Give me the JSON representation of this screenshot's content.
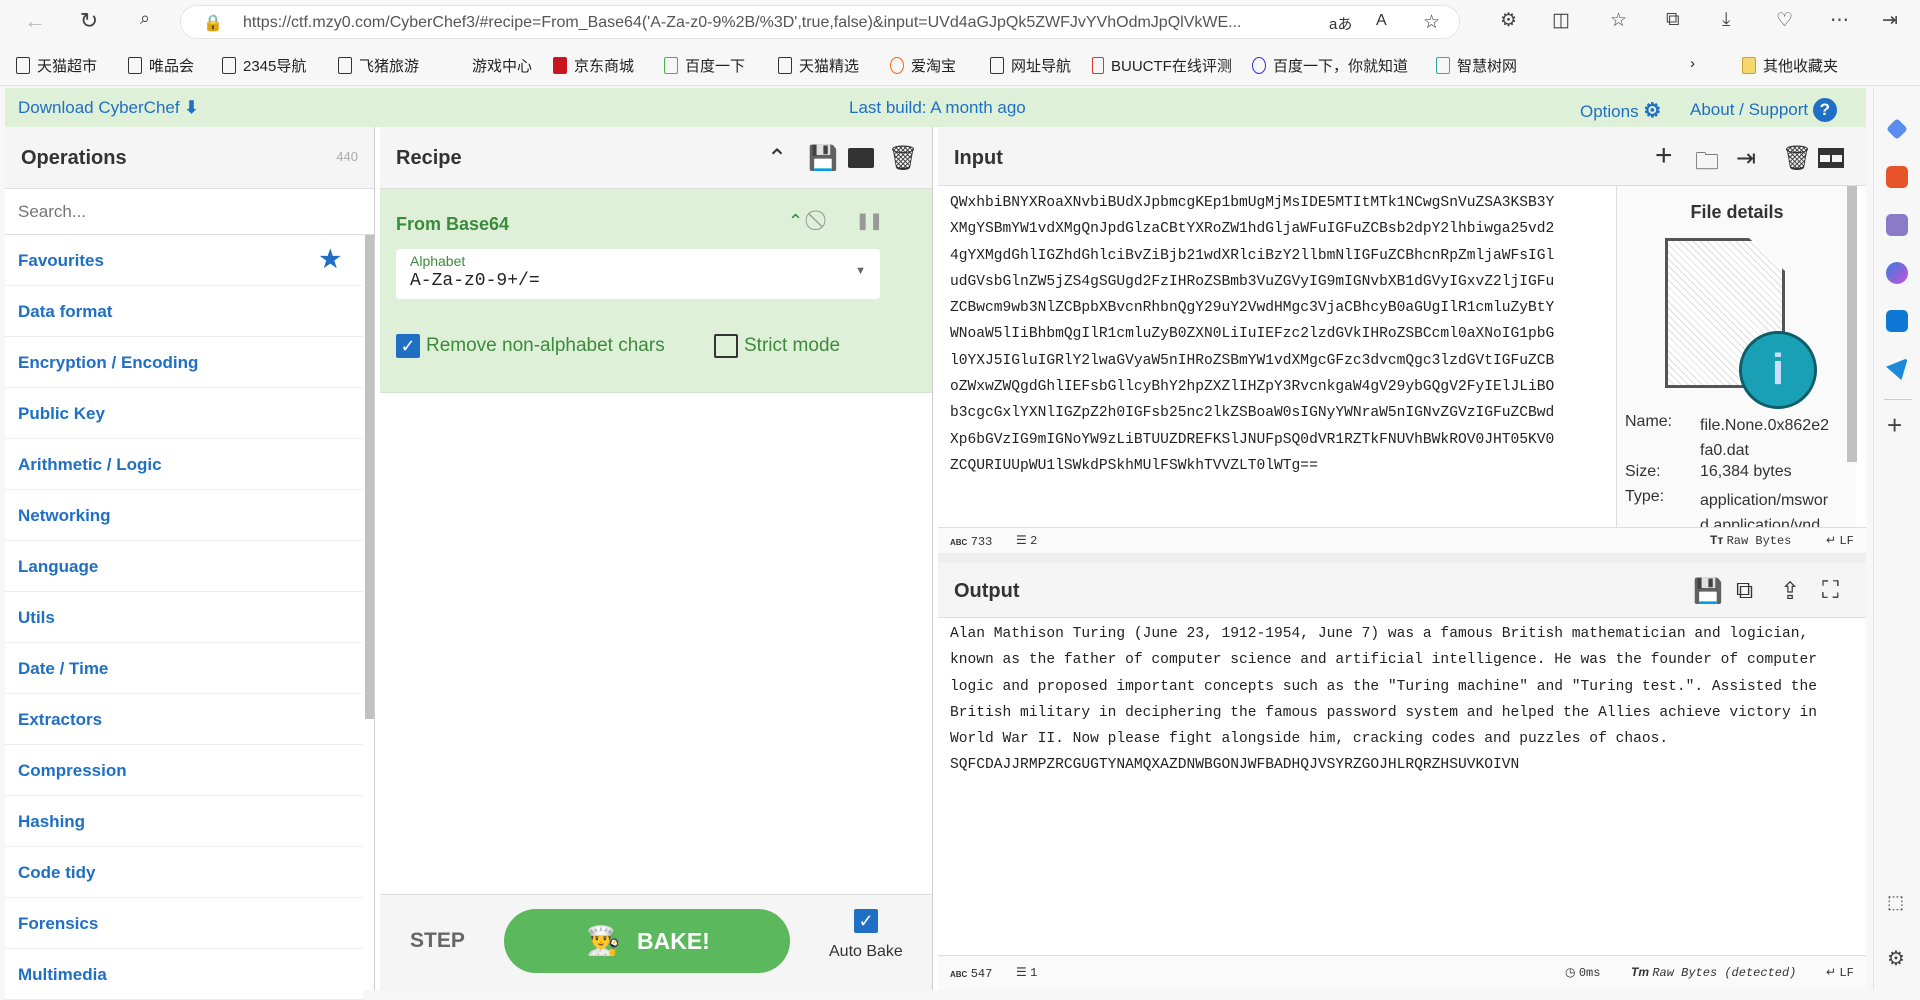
{
  "browser": {
    "url": "https://ctf.mzy0.com/CyberChef3/#recipe=From_Base64('A-Za-z0-9%2B/%3D',true,false)&input=UVd4aGJpQk5ZWFJvYVhOdmJpQlVkWE...",
    "bookmarks": [
      "天猫超市",
      "唯品会",
      "2345导航",
      "飞猪旅游",
      "游戏中心",
      "京东商城",
      "百度一下",
      "天猫精选",
      "爱淘宝",
      "网址导航",
      "BUUCTF在线评测",
      "百度一下，你就知道",
      "智慧树网"
    ],
    "other_bookmarks": "其他收藏夹"
  },
  "banner": {
    "download": "Download CyberChef",
    "build": "Last build: A month ago",
    "options": "Options",
    "about": "About / Support"
  },
  "operations": {
    "title": "Operations",
    "count": "440",
    "search_placeholder": "Search...",
    "categories": [
      "Favourites",
      "Data format",
      "Encryption / Encoding",
      "Public Key",
      "Arithmetic / Logic",
      "Networking",
      "Language",
      "Utils",
      "Date / Time",
      "Extractors",
      "Compression",
      "Hashing",
      "Code tidy",
      "Forensics",
      "Multimedia"
    ]
  },
  "recipe": {
    "title": "Recipe",
    "operation": "From Base64",
    "alphabet_label": "Alphabet",
    "alphabet_value": "A-Za-z0-9+/=",
    "remove_nonalpha": "Remove non-alphabet chars",
    "remove_nonalpha_checked": true,
    "strict_mode": "Strict mode",
    "strict_mode_checked": false,
    "step": "STEP",
    "bake": "BAKE!",
    "auto_bake": "Auto Bake",
    "auto_bake_checked": true
  },
  "input": {
    "title": "Input",
    "lines": [
      "QWxhbiBNYXRoaXNvbiBUdXJpbmcgKEp1bmUgMjMsIDE5MTItMTk1NCwgSnVuZSA3KSB3Y",
      "XMgYSBmYW1vdXMgQnJpdGlzaCBtYXRoZW1hdGljaWFuIGFuZCBsb2dpY2lhbiwga25vd2",
      "4gYXMgdGhlIGZhdGhlciBvZiBjb21wdXRlciBzY2llbmNlIGFuZCBhcnRpZmljaWFsIGl",
      "udGVsbGlnZW5jZS4gSGUgd2FzIHRoZSBmb3VuZGVyIG9mIGNvbXB1dGVyIGxvZ2ljIGFu",
      "ZCBwcm9wb3NlZCBpbXBvcnRhbnQgY29uY2VwdHMgc3VjaCBhcyB0aGUgIlR1cmluZyBtY",
      "WNoaW5lIiBhbmQgIlR1cmluZyB0ZXN0LiIuIEFzc2lzdGVkIHRoZSBCcml0aXNoIG1pbG",
      "l0YXJ5IGluIGRlY2lwaGVyaW5nIHRoZSBmYW1vdXMgcGFzc3dvcmQgc3lzdGVtIGFuZCB",
      "oZWxwZWQgdGhlIEFsbGllcyBhY2hpZXZlIHZpY3RvcnkgaW4gV29ybGQgV2FyIElJLiBO",
      "b3cgcGxlYXNlIGZpZ2h0IGFsb25nc2lkZSBoaW0sIGNyYWNraW5nIGNvZGVzIGFuZCBwd",
      "Xp6bGVzIG9mIGNoYW9zLiBTUUZDREFKSlJNUFpSQ0dVR1RZTkFNUVhBWkROV0JHT05KV0",
      "ZCQURIUUpWU1lSWkdPSkhMUlFSWkhTVVZLT0lWTg=="
    ],
    "chars": "733",
    "lines_count": "2",
    "encoding": "Raw Bytes",
    "eol": "LF",
    "file": {
      "title": "File details",
      "name_label": "Name:",
      "name": "file.None.0x862e2fa0.dat",
      "size_label": "Size:",
      "size": "16,384 bytes",
      "type_label": "Type:",
      "type": "application/msword application/vnd"
    }
  },
  "output": {
    "title": "Output",
    "text": "Alan Mathison Turing (June 23, 1912-1954, June 7) was a famous British mathematician and logician, known as the father of computer science and artificial intelligence. He was the founder of computer logic and proposed important concepts such as the \"Turing machine\" and \"Turing test.\". Assisted the British military in deciphering the famous password system and helped the Allies achieve victory in World War II. Now please fight alongside him, cracking codes and puzzles of chaos. SQFCDAJJRMPZRCGUGTYNAMQXAZDNWBGONJWFBADHQJVSYRZGOJHLRQRZHSUVKOIVN",
    "chars": "547",
    "lines_count": "1",
    "time": "0ms",
    "encoding": "Raw Bytes (detected)",
    "eol": "LF"
  },
  "colors": {
    "accent": "#1f6fc4",
    "banner_bg": "#dff0d8",
    "op_green": "#3c8a3c",
    "bake": "#5cb85c"
  }
}
